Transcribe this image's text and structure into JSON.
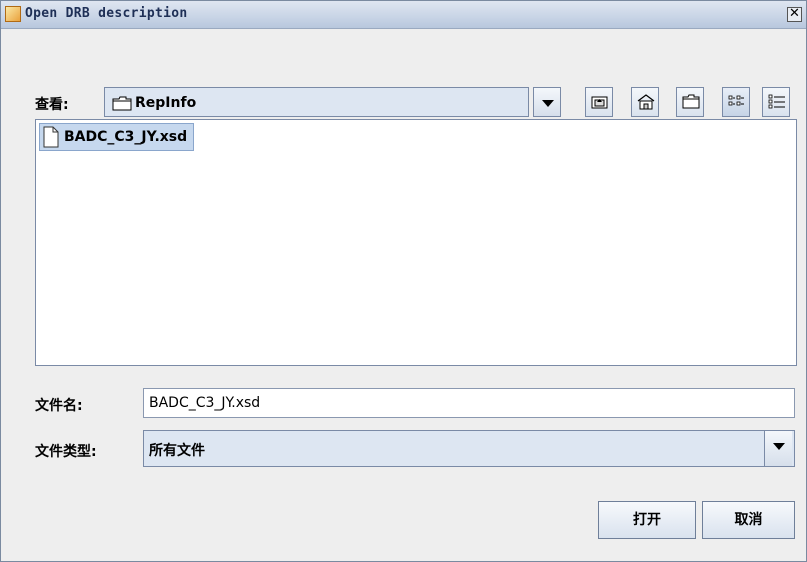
{
  "window": {
    "title": "Open DRB description",
    "close_symbol": "✕"
  },
  "look_in": {
    "label": "查看:",
    "value": "RepInfo"
  },
  "toolbar": {
    "up_icon": "up-folder-icon",
    "home_icon": "home-icon",
    "new_folder_icon": "new-folder-icon",
    "list_view_icon": "list-view-icon",
    "details_view_icon": "details-view-icon"
  },
  "files": [
    {
      "name": "BADC_C3_JY.xsd",
      "icon": "file-icon"
    }
  ],
  "file_name": {
    "label": "文件名:",
    "value": "BADC_C3_JY.xsd"
  },
  "file_type": {
    "label": "文件类型:",
    "value": "所有文件"
  },
  "buttons": {
    "open": "打开",
    "cancel": "取消"
  }
}
